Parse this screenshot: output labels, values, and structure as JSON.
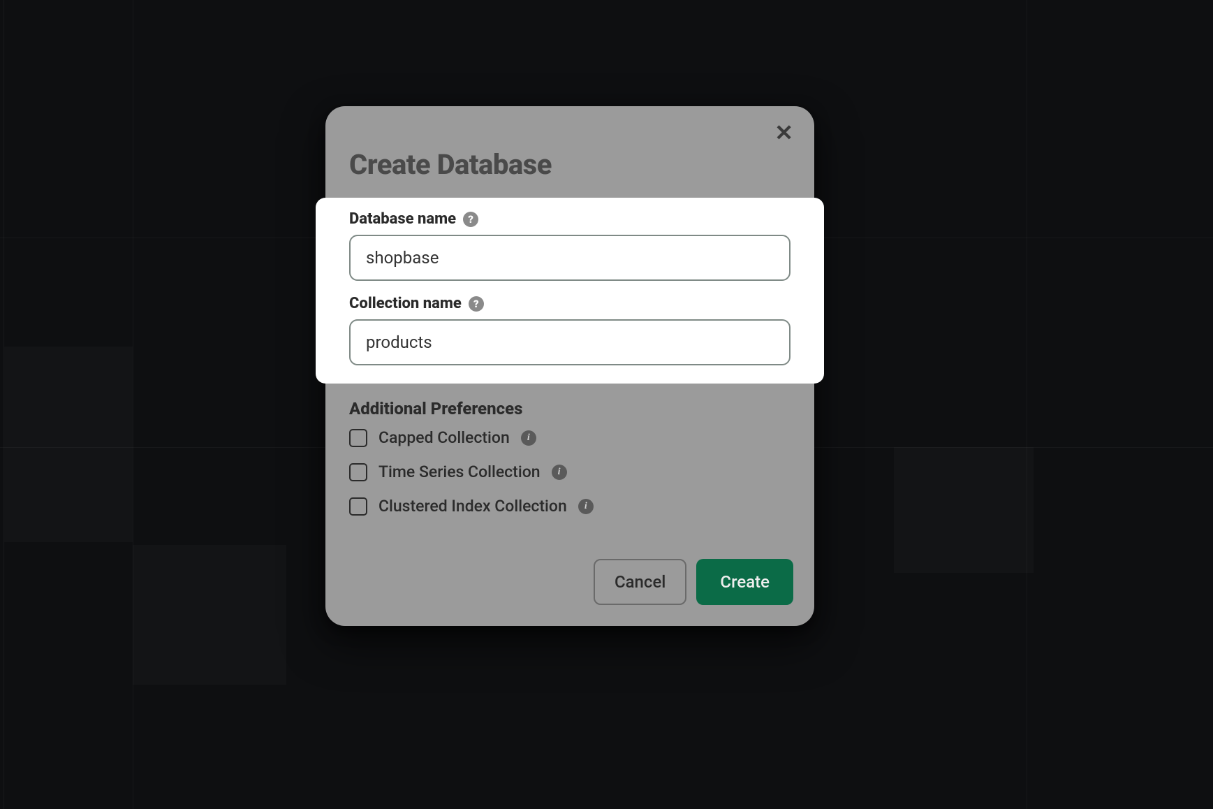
{
  "modal": {
    "title": "Create Database",
    "close_label": "✕",
    "fields": {
      "database_name": {
        "label": "Database name",
        "value": "shopbase"
      },
      "collection_name": {
        "label": "Collection name",
        "value": "products"
      }
    },
    "preferences": {
      "title": "Additional Preferences",
      "options": {
        "capped": {
          "label": "Capped Collection",
          "checked": false
        },
        "timeseries": {
          "label": "Time Series Collection",
          "checked": false
        },
        "clustered": {
          "label": "Clustered Index Collection",
          "checked": false
        }
      }
    },
    "buttons": {
      "cancel": "Cancel",
      "create": "Create"
    }
  },
  "icons": {
    "help": "?",
    "info": "i"
  }
}
